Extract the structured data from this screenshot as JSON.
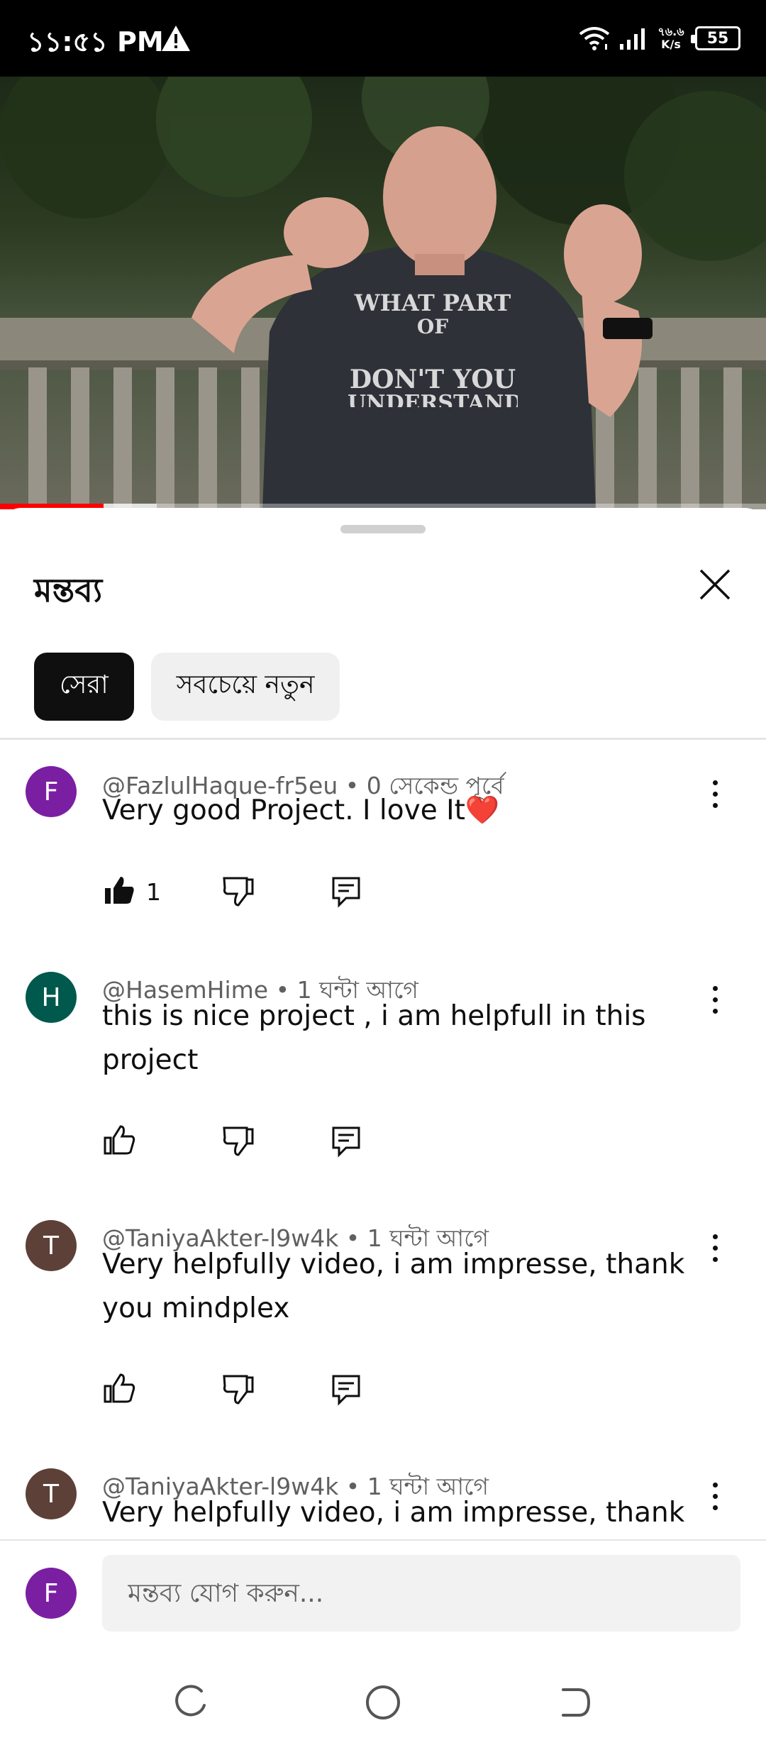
{
  "status_bar": {
    "time": "১১:৫১ PM",
    "net_speed_value": "৭৬.৬",
    "net_speed_unit": "K/s",
    "battery": "55",
    "icons": [
      "warning-icon",
      "wifi-icon",
      "signal-icon",
      "battery-icon"
    ]
  },
  "video": {
    "shirt_text": [
      "WHAT PART",
      "OF",
      "DON'T YOU",
      "UNDERSTAND"
    ],
    "progress_fraction": 0.135,
    "buffer_fraction": 0.205
  },
  "comments_panel": {
    "title": "মন্তব্য",
    "close_icon": "close-icon",
    "chips": [
      {
        "label": "সেরা",
        "active": true
      },
      {
        "label": "সবচেয়ে নতুন",
        "active": false
      }
    ],
    "comments": [
      {
        "avatar_letter": "F",
        "avatar_color": "#7b1fa2",
        "author": "@FazlulHaque-fr5eu",
        "time": "0 সেকেন্ড পূর্বে",
        "text": "Very good Project. I love It❤️",
        "like_count": "1",
        "liked": true
      },
      {
        "avatar_letter": "H",
        "avatar_color": "#00594c",
        "author": "@HasemHime",
        "time": "1 ঘন্টা আগে",
        "text": "this is nice project , i am helpfull in this project",
        "like_count": "",
        "liked": false
      },
      {
        "avatar_letter": "T",
        "avatar_color": "#5d4037",
        "author": "@TaniyaAkter-l9w4k",
        "time": "1 ঘন্টা আগে",
        "text": "Very helpfully video, i am impresse, thank you mindplex",
        "like_count": "",
        "liked": false
      },
      {
        "avatar_letter": "T",
        "avatar_color": "#5d4037",
        "author": "@TaniyaAkter-l9w4k",
        "time": "1 ঘন্টা আগে",
        "text": "Very helpfully video, i am impresse, thank you",
        "like_count": "",
        "liked": false
      }
    ]
  },
  "composer": {
    "avatar_letter": "F",
    "placeholder": "মন্তব্য যোগ করুন..."
  },
  "nav_bar": {
    "icons": [
      "recents-icon",
      "home-icon",
      "back-icon"
    ]
  }
}
